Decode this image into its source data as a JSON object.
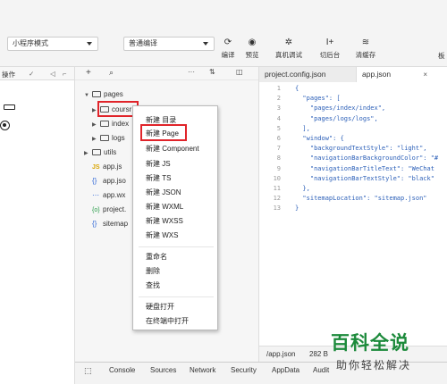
{
  "toolbar": {
    "mode_select": "小程序模式",
    "compile_select": "普通编译",
    "tools": [
      {
        "icon": "refresh-icon",
        "glyph": "⟳",
        "label": "编译"
      },
      {
        "icon": "eye-icon",
        "glyph": "◉",
        "label": "预览"
      },
      {
        "icon": "bug-icon",
        "glyph": "✲",
        "label": "真机调试"
      },
      {
        "icon": "cut-background-icon",
        "glyph": "I+",
        "label": "切后台"
      },
      {
        "icon": "layers-icon",
        "glyph": "≋",
        "label": "清缓存"
      }
    ],
    "right_edge_label": "板"
  },
  "sim_strip": {
    "head_label": "操作"
  },
  "explorer": {
    "tree": [
      {
        "name": "pages",
        "type": "folder",
        "expanded": true
      },
      {
        "name": "coursr",
        "type": "folder",
        "expanded": false
      },
      {
        "name": "index",
        "type": "folder",
        "expanded": false
      },
      {
        "name": "logs",
        "type": "folder",
        "expanded": false
      },
      {
        "name": "utils",
        "type": "folder",
        "expanded": false
      },
      {
        "name": "app.js",
        "type": "js"
      },
      {
        "name": "app.jso",
        "type": "json"
      },
      {
        "name": "app.wx",
        "type": "wxss"
      },
      {
        "name": "project.",
        "type": "config"
      },
      {
        "name": "sitemap",
        "type": "json"
      }
    ]
  },
  "context_menu": {
    "items": [
      "新建 目录",
      "新建 Page",
      "新建 Component",
      "新建 JS",
      "新建 TS",
      "新建 JSON",
      "新建 WXML",
      "新建 WXSS",
      "新建 WXS"
    ],
    "items2": [
      "重命名",
      "删除",
      "查找"
    ],
    "items3": [
      "硬盘打开",
      "在终端中打开"
    ]
  },
  "editor": {
    "tabs": [
      "project.config.json",
      "app.json"
    ],
    "lines": [
      {
        "n": "1",
        "t": "{"
      },
      {
        "n": "2",
        "t": "  \"pages\": ["
      },
      {
        "n": "3",
        "t": "    \"pages/index/index\","
      },
      {
        "n": "4",
        "t": "    \"pages/logs/logs\","
      },
      {
        "n": "5",
        "t": "  ],"
      },
      {
        "n": "6",
        "t": "  \"window\": {"
      },
      {
        "n": "7",
        "t": "    \"backgroundTextStyle\": \"light\","
      },
      {
        "n": "8",
        "t": "    \"navigationBarBackgroundColor\": \"#"
      },
      {
        "n": "9",
        "t": "    \"navigationBarTitleText\": \"WeChat"
      },
      {
        "n": "10",
        "t": "    \"navigationBarTextStyle\": \"black\""
      },
      {
        "n": "11",
        "t": "  },"
      },
      {
        "n": "12",
        "t": "  \"sitemapLocation\": \"sitemap.json\""
      },
      {
        "n": "13",
        "t": "}"
      }
    ],
    "status_path": "/app.json",
    "status_size": "282 B"
  },
  "devtools": {
    "tabs": [
      "Console",
      "Sources",
      "Network",
      "Security",
      "AppData",
      "Audit"
    ]
  },
  "watermark": {
    "logo": "百科全说",
    "sub": "助你轻松解决"
  },
  "colors": {
    "highlight": "#e0242a",
    "watermark": "#1c8a3b"
  }
}
